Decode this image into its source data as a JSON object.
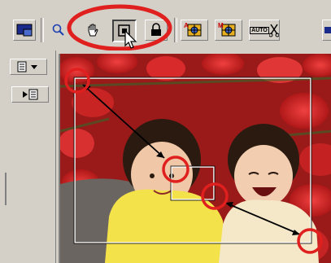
{
  "toolbar": {
    "buttons": [
      {
        "name": "color-mode-button",
        "icon": "monitor-color-icon",
        "state": "raised"
      },
      {
        "name": "zoom-button",
        "icon": "magnifier-icon",
        "state": "flat"
      },
      {
        "name": "hand-tool-button",
        "icon": "hand-icon",
        "state": "flat"
      },
      {
        "name": "crop-tool-button",
        "icon": "crop-frame-icon",
        "state": "pressed"
      },
      {
        "name": "lock-button",
        "icon": "lock-icon",
        "state": "raised"
      },
      {
        "name": "auto-focus-button",
        "icon": "af-target-icon",
        "state": "raised",
        "label": "A"
      },
      {
        "name": "manual-focus-button",
        "icon": "mf-target-icon",
        "state": "raised",
        "label": "M"
      },
      {
        "name": "auto-adjust-button",
        "icon": "auto-scissors-icon",
        "state": "raised",
        "label": "AUTO"
      }
    ],
    "highlight_color": "#e0201e"
  },
  "left_panel": {
    "menu_buttons": [
      {
        "icon": "list-dropdown-icon"
      },
      {
        "icon": "arrow-list-icon"
      }
    ]
  },
  "preview": {
    "crop_frame": "outer",
    "colors": {
      "highlight": "#e0201e",
      "frame": "#ffffff",
      "arrow": "#000000"
    }
  }
}
